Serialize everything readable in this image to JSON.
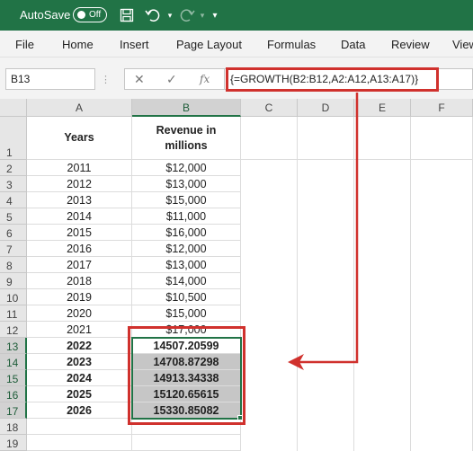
{
  "titlebar": {
    "autosave_label": "AutoSave",
    "autosave_state": "Off",
    "icons": [
      "save-icon",
      "undo-icon",
      "redo-icon",
      "customize-qat-icon"
    ]
  },
  "menu": {
    "items": [
      "File",
      "Home",
      "Insert",
      "Page Layout",
      "Formulas",
      "Data",
      "Review",
      "View"
    ]
  },
  "formula_bar": {
    "name_box": "B13",
    "formula": "{=GROWTH(B2:B12,A2:A12,A13:A17)}"
  },
  "columns": [
    "A",
    "B",
    "C",
    "D",
    "E",
    "F"
  ],
  "rows": [
    "1",
    "2",
    "3",
    "4",
    "5",
    "6",
    "7",
    "8",
    "9",
    "10",
    "11",
    "12",
    "13",
    "14",
    "15",
    "16",
    "17",
    "18",
    "19"
  ],
  "sheet": {
    "header": {
      "years": "Years",
      "revenue_line1": "Revenue in",
      "revenue_line2": "millions"
    },
    "data": [
      [
        "2011",
        "$12,000"
      ],
      [
        "2012",
        "$13,000"
      ],
      [
        "2013",
        "$15,000"
      ],
      [
        "2014",
        "$11,000"
      ],
      [
        "2015",
        "$16,000"
      ],
      [
        "2016",
        "$12,000"
      ],
      [
        "2017",
        "$13,000"
      ],
      [
        "2018",
        "$14,000"
      ],
      [
        "2019",
        "$10,500"
      ],
      [
        "2020",
        "$15,000"
      ],
      [
        "2021",
        "$17,000"
      ],
      [
        "2022",
        "14507.20599"
      ],
      [
        "2023",
        "14708.87298"
      ],
      [
        "2024",
        "14913.34338"
      ],
      [
        "2025",
        "15120.65615"
      ],
      [
        "2026",
        "15330.85082"
      ]
    ]
  },
  "colors": {
    "title_bar": "#217346",
    "highlight_red": "#d0312d",
    "selection_green": "#217346"
  }
}
